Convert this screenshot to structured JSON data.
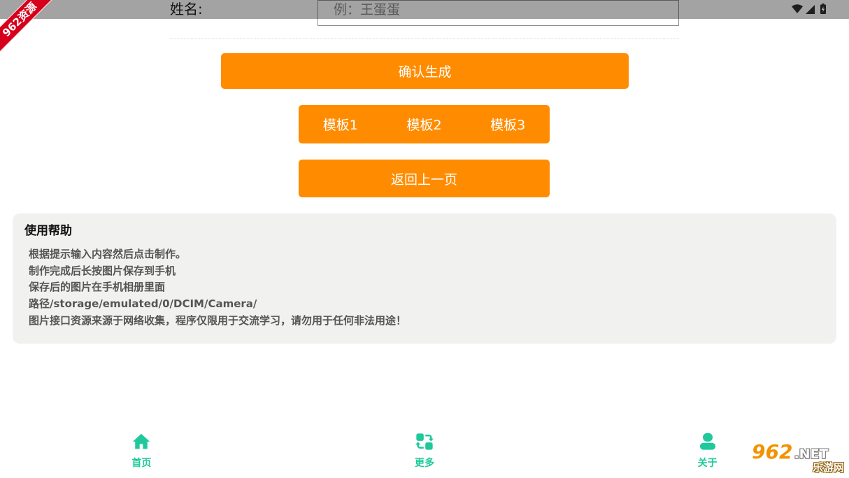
{
  "status_bar": {
    "icons": [
      "wifi-icon",
      "signal-icon",
      "battery-icon"
    ]
  },
  "form": {
    "name_label": "姓名:",
    "name_placeholder": "例：王蛋蛋",
    "name_value": ""
  },
  "actions": {
    "confirm_label": "确认生成",
    "templates": [
      "模板1",
      "模板2",
      "模板3"
    ],
    "back_label": "返回上一页"
  },
  "help": {
    "title": "使用帮助",
    "lines": [
      "根据提示输入内容然后点击制作。",
      "制作完成后长按图片保存到手机",
      "保存后的图片在手机相册里面",
      "路径/storage/emulated/0/DCIM/Camera/",
      "图片接口资源来源于网络收集，程序仅限用于交流学习，请勿用于任何非法用途！"
    ]
  },
  "bottom_nav": [
    {
      "label": "首页",
      "icon": "home-icon"
    },
    {
      "label": "更多",
      "icon": "more-icon"
    },
    {
      "label": "关于",
      "icon": "user-icon"
    }
  ],
  "watermarks": {
    "corner_ribbon": "962资源",
    "logo": {
      "number": "962",
      "suffix": ".NET",
      "sub": "乐游网"
    }
  },
  "colors": {
    "accent": "#ff8c00",
    "nav": "#1fc99b",
    "help_card_bg": "#f1f2f0",
    "status_bar": "#a3a3a3"
  }
}
